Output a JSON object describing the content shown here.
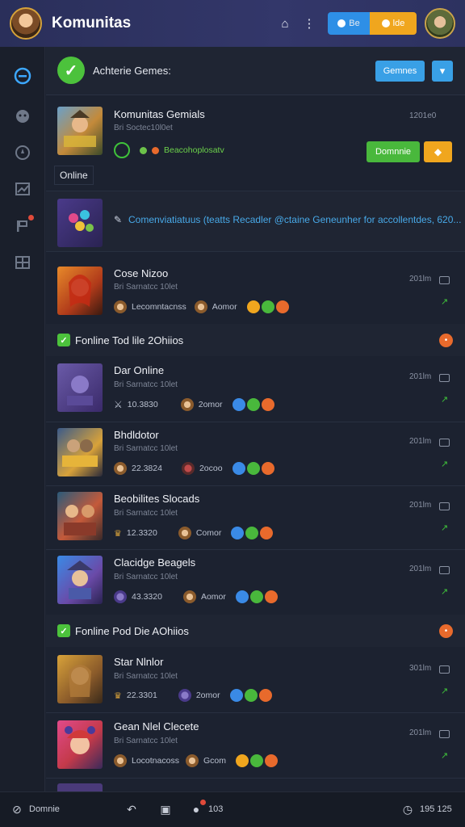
{
  "app": {
    "title": "Komunitas"
  },
  "header": {
    "pill_blue_label": "Be",
    "pill_yellow_label": "lde"
  },
  "sidebar": {
    "items": [
      {
        "icon": "explore-icon"
      },
      {
        "icon": "chat-icon"
      },
      {
        "icon": "compass-icon"
      },
      {
        "icon": "stats-icon"
      },
      {
        "icon": "flag-icon"
      },
      {
        "icon": "grid-icon"
      }
    ]
  },
  "topbar": {
    "title": "Achterie Gemes:",
    "button_label": "Gemnes"
  },
  "featured": {
    "title": "Komunitas Gemials",
    "subtitle": "Bri Soctec10l0et",
    "activity": "Beacohoplosatv",
    "time": "1201e0",
    "join_label": "Domnnie",
    "online_label": "Online"
  },
  "promo": {
    "text": "Comenviatiatuus (teatts Recadler @ctaine Geneunher for accollentdes, 620..."
  },
  "rows_group1": [
    {
      "title": "Cose Nizoo",
      "subtitle": "Bri Sarnatcc 10let",
      "stat1": "Lecomntacnss",
      "stat2": "Aomor",
      "time": "201lm"
    }
  ],
  "sections": [
    {
      "title": "Fonline Tod lile 2Ohiios",
      "badge": "•"
    },
    {
      "title": "Fonline Pod Die AOhiios",
      "badge": "•"
    }
  ],
  "rows_group2": [
    {
      "title": "Dar Online",
      "subtitle": "Bri Sarnatcc 10let",
      "stat1": "10.3830",
      "stat2": "2omor",
      "time": "201lm"
    },
    {
      "title": "Bhdldotor",
      "subtitle": "Bri Sarnatcc 10let",
      "stat1": "22.3824",
      "stat2": "2ocoo",
      "time": "201lm"
    },
    {
      "title": "Beobilites Slocads",
      "subtitle": "Bri Sarnatcc 10let",
      "stat1": "12.3320",
      "stat2": "Comor",
      "time": "201lm"
    },
    {
      "title": "Clacidge Beagels",
      "subtitle": "Bri Sarnatcc 10let",
      "stat1": "43.3320",
      "stat2": "Aomor",
      "time": "201lm"
    }
  ],
  "rows_group3": [
    {
      "title": "Star Nlnlor",
      "subtitle": "Bri Sarnatcc 10let",
      "stat1": "22.3301",
      "stat2": "2omor",
      "time": "301lm"
    },
    {
      "title": "Gean Nlel Clecete",
      "subtitle": "Bri Sarnatcc 10let",
      "stat1": "Locotnacoss",
      "stat2": "Gcom",
      "time": "201lm"
    }
  ],
  "bottombar": {
    "left_label": "Domnie",
    "center_count": "103",
    "right_label": "195 125"
  },
  "colors": {
    "accent_blue": "#39a0e6",
    "accent_green": "#49b83c",
    "accent_orange": "#f0a61e",
    "badge_red": "#e86a2c"
  }
}
